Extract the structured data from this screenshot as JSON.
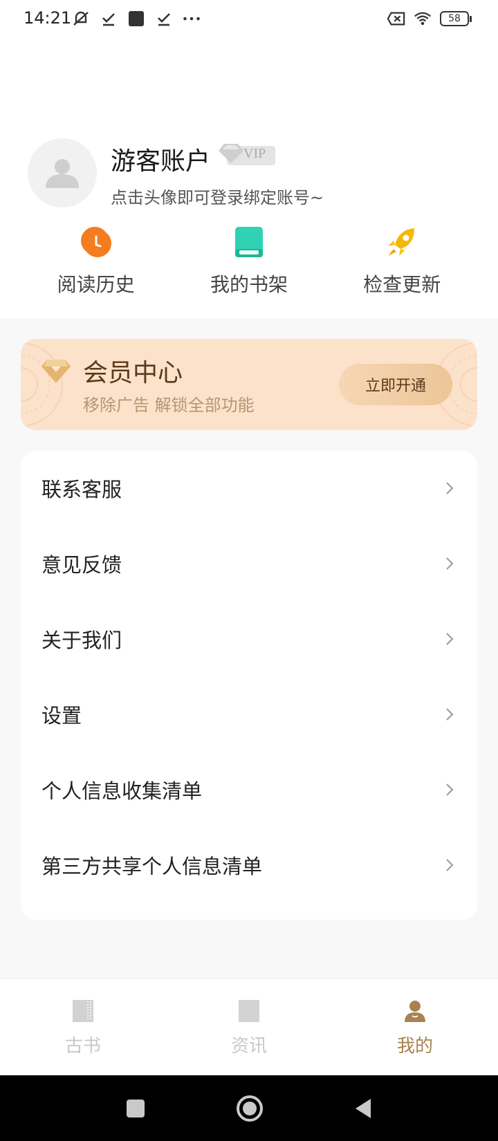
{
  "status_bar": {
    "time": "14:21",
    "battery": "58"
  },
  "profile": {
    "username": "游客账户",
    "vip_badge": "VIP",
    "login_hint": "点击头像即可登录绑定账号~"
  },
  "quick_actions": [
    {
      "label": "阅读历史",
      "icon": "clock-icon",
      "color": "#f57c1f"
    },
    {
      "label": "我的书架",
      "icon": "book-icon",
      "color": "#2fd3b4"
    },
    {
      "label": "检查更新",
      "icon": "rocket-icon",
      "color": "#f5b800"
    }
  ],
  "vip_banner": {
    "title": "会员中心",
    "subtitle": "移除广告 解锁全部功能",
    "button_label": "立即开通"
  },
  "menu": [
    {
      "label": "联系客服"
    },
    {
      "label": "意见反馈"
    },
    {
      "label": "关于我们"
    },
    {
      "label": "设置"
    },
    {
      "label": "个人信息收集清单"
    },
    {
      "label": "第三方共享个人信息清单"
    }
  ],
  "bottom_nav": [
    {
      "label": "古书",
      "active": false
    },
    {
      "label": "资讯",
      "active": false
    },
    {
      "label": "我的",
      "active": true
    }
  ],
  "colors": {
    "accent": "#a8824f",
    "vip_banner_bg": "#fde2cb",
    "inactive_nav": "#c8c8c8"
  }
}
